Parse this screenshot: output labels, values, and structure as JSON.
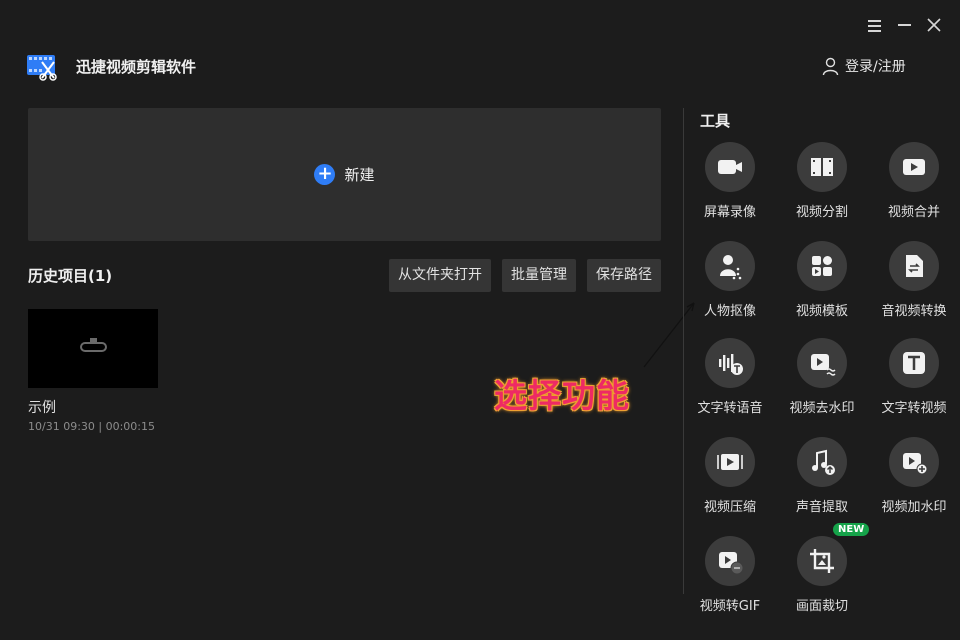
{
  "header": {
    "app_title": "迅捷视频剪辑软件",
    "login_label": "登录/注册"
  },
  "window_controls": [
    "menu-icon",
    "minimize-icon",
    "close-icon"
  ],
  "new_project": {
    "label": "新建"
  },
  "history": {
    "title": "历史项目(1)",
    "actions": [
      "从文件夹打开",
      "批量管理",
      "保存路径"
    ],
    "items": [
      {
        "name": "示例",
        "meta": "10/31 09:30 | 00:00:15"
      }
    ]
  },
  "annotation": {
    "text": "选择功能"
  },
  "tools": {
    "title": "工具",
    "badge": "NEW",
    "items": [
      {
        "label": "屏幕录像",
        "icon": "camera-icon"
      },
      {
        "label": "视频分割",
        "icon": "film-split-icon"
      },
      {
        "label": "视频合并",
        "icon": "video-merge-icon"
      },
      {
        "label": "人物抠像",
        "icon": "person-cutout-icon"
      },
      {
        "label": "视频模板",
        "icon": "template-icon"
      },
      {
        "label": "音视频转换",
        "icon": "convert-icon"
      },
      {
        "label": "文字转语音",
        "icon": "text-to-speech-icon"
      },
      {
        "label": "视频去水印",
        "icon": "remove-watermark-icon"
      },
      {
        "label": "文字转视频",
        "icon": "text-to-video-icon"
      },
      {
        "label": "视频压缩",
        "icon": "compress-icon"
      },
      {
        "label": "声音提取",
        "icon": "audio-extract-icon"
      },
      {
        "label": "视频加水印",
        "icon": "add-watermark-icon"
      },
      {
        "label": "视频转GIF",
        "icon": "gif-icon"
      },
      {
        "label": "画面裁切",
        "icon": "crop-icon"
      }
    ]
  },
  "colors": {
    "background": "#1c1c1c",
    "panel": "#2e2e2e",
    "accent": "#2f7df6",
    "annotation": "#ee2a64",
    "badge": "#16a34a"
  }
}
